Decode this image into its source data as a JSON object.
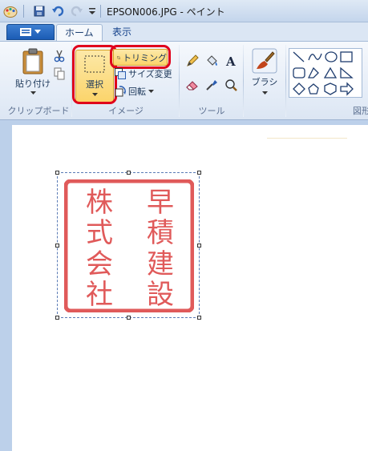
{
  "title": "EPSON006.JPG - ペイント",
  "tabs": {
    "file_label": "",
    "home": "ホーム",
    "view": "表示"
  },
  "clipboard": {
    "paste_label": "貼り付け",
    "group_label": "クリップボード"
  },
  "image": {
    "select_label": "選択",
    "crop_label": "トリミング",
    "resize_label": "サイズ変更",
    "rotate_label": "回転",
    "group_label": "イメージ"
  },
  "tools": {
    "group_label": "ツール"
  },
  "brush": {
    "label": "ブラシ"
  },
  "shapes": {
    "group_label": "図形"
  },
  "seal": {
    "color": "#e05a5a",
    "right_column": "早積建設",
    "left_column": "株式会社"
  },
  "colors": {
    "highlight": "#e0001b",
    "ribbon_accent": "#fbd46b"
  }
}
